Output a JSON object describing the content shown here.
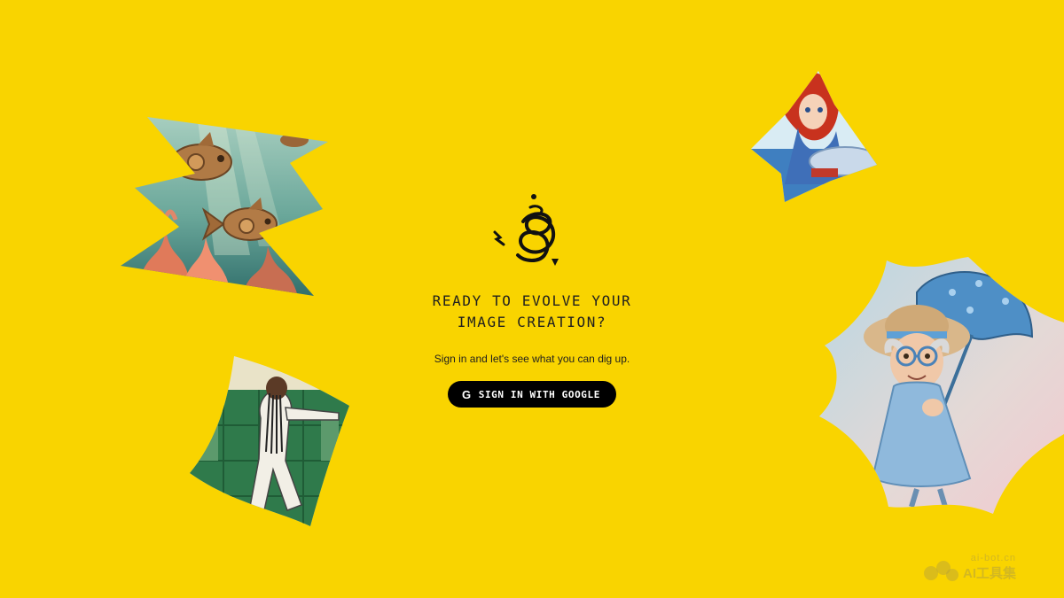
{
  "main": {
    "headline_line1": "READY TO EVOLVE YOUR",
    "headline_line2": "IMAGE CREATION?",
    "subtext": "Sign in and let's see what you can dig up.",
    "signin_label": "SIGN IN WITH GOOGLE",
    "google_glyph": "G"
  },
  "watermark": {
    "top": "ai-bot.cn",
    "bottom": "AI工具集"
  },
  "colors": {
    "background": "#F9D400",
    "button": "#000000",
    "text": "#1f1f1f"
  },
  "icons": [
    "squiggle-logo-icon",
    "google-g-icon"
  ]
}
